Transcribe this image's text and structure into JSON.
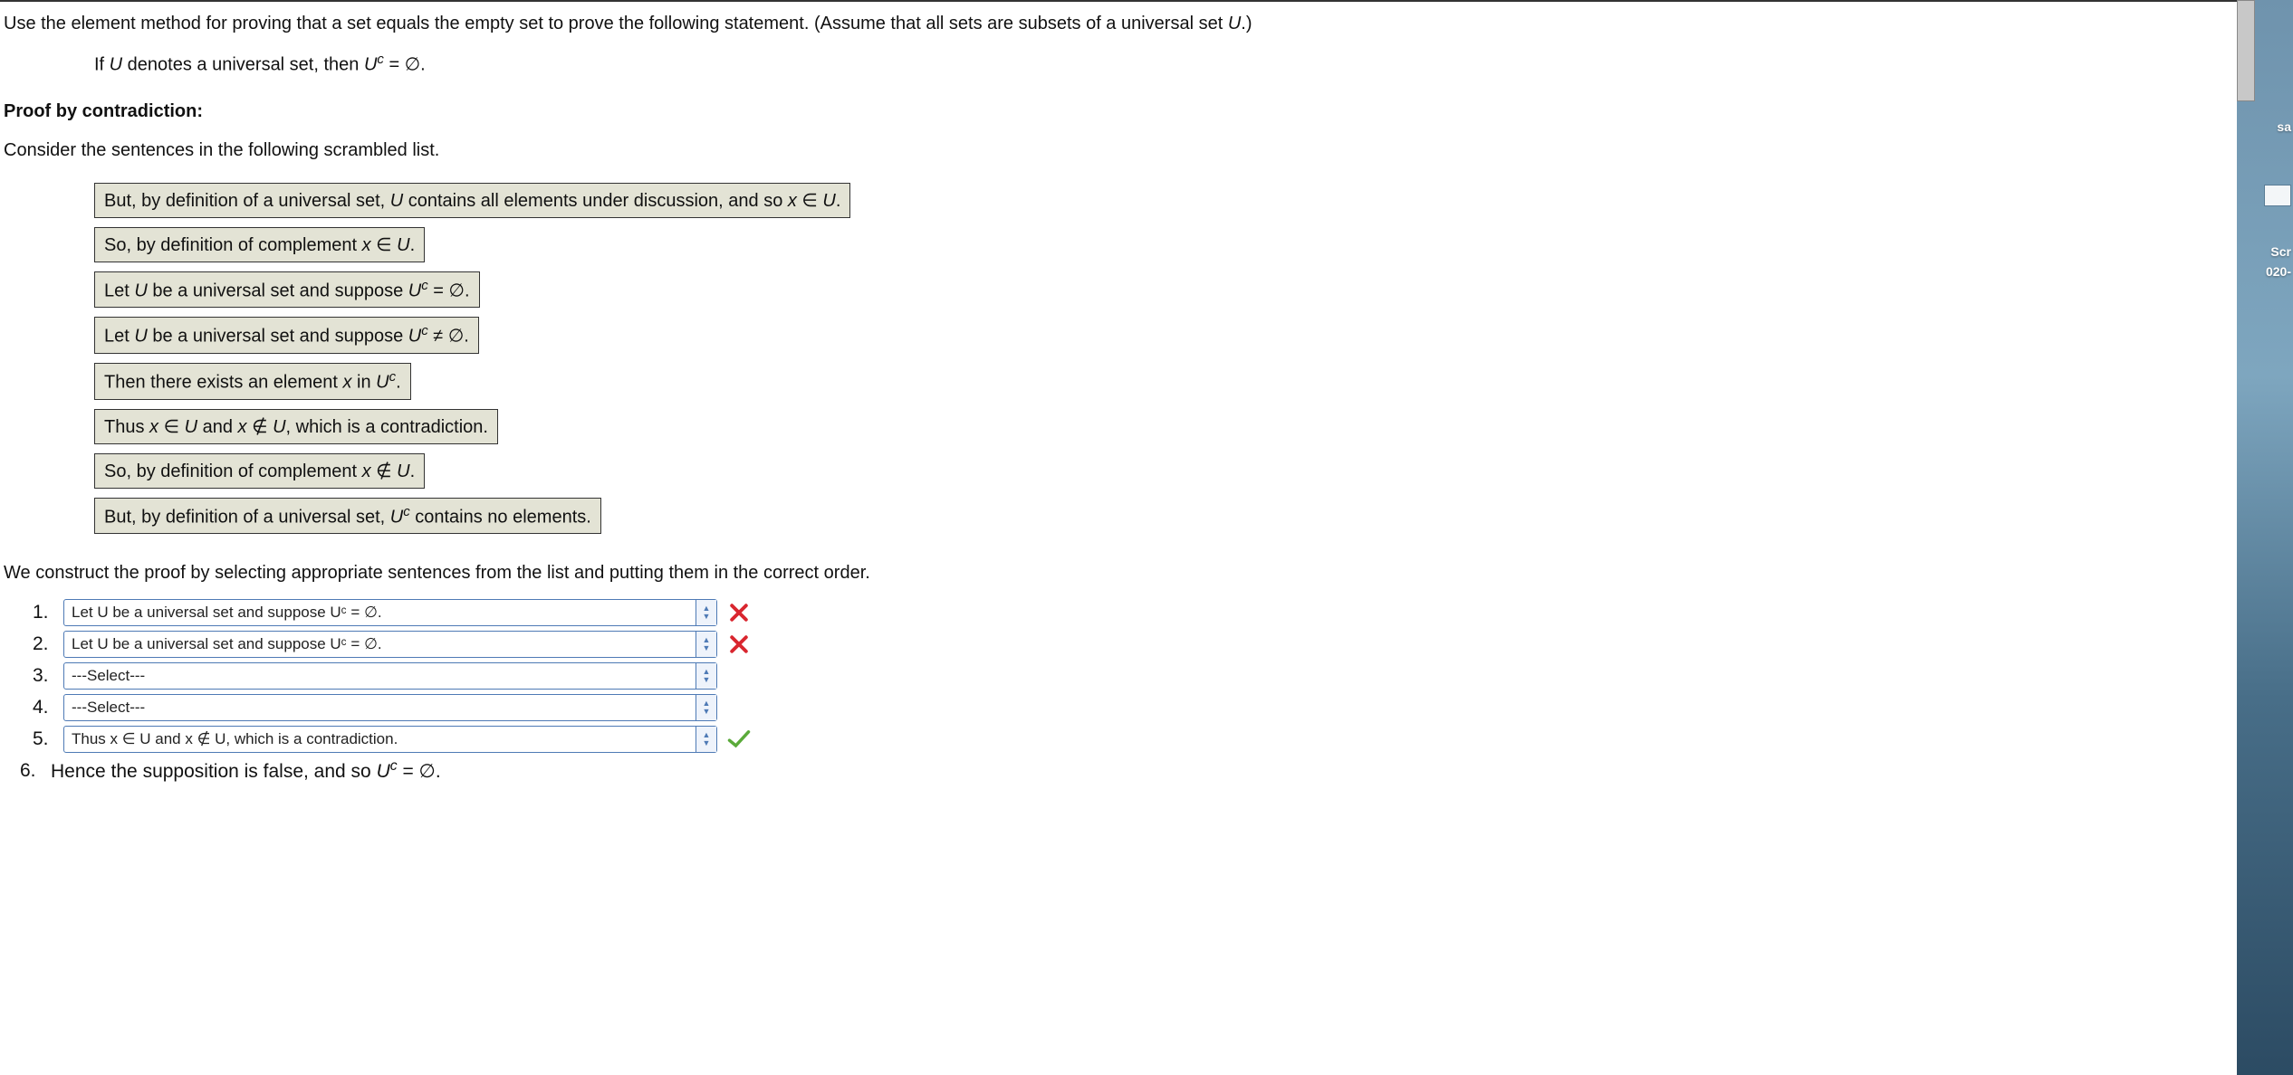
{
  "prompt": {
    "intro": "Use the element method for proving that a set equals the empty set to prove the following statement. (Assume that all sets are subsets of a universal set ",
    "intro_u": "U",
    "intro_end": ".)",
    "claim_pre": "If ",
    "claim_u": "U",
    "claim_mid": " denotes a universal set, then ",
    "claim_uc": "U",
    "claim_sup": "c",
    "claim_eq": " = ∅."
  },
  "headings": {
    "proof_by_contradiction": "Proof by contradiction:",
    "consider": "Consider the sentences in the following scrambled list.",
    "construct": "We construct the proof by selecting appropriate sentences from the list and putting them in the correct order."
  },
  "scrambled": [
    {
      "html": "But, by definition of a universal set, <span class='i'>U</span> contains all elements under discussion, and so <span class='i'>x</span> ∈ <span class='i'>U</span>."
    },
    {
      "html": "So, by definition of complement <span class='i'>x</span> ∈ <span class='i'>U</span>."
    },
    {
      "html": "Let <span class='i'>U</span> be a universal set and suppose <span class='i'>U</span><sup>c</sup> = ∅."
    },
    {
      "html": "Let <span class='i'>U</span> be a universal set and suppose <span class='i'>U</span><sup>c</sup> ≠ ∅."
    },
    {
      "html": "Then there exists an element <span class='i'>x</span> in <span class='i'>U</span><sup>c</sup>."
    },
    {
      "html": "Thus <span class='i'>x</span> ∈ <span class='i'>U</span> and <span class='i'>x</span> ∉ <span class='i'>U</span>, which is a contradiction."
    },
    {
      "html": "So, by definition of complement <span class='i'>x</span> ∉ <span class='i'>U</span>."
    },
    {
      "html": "But, by definition of a universal set, <span class='i'>U</span><sup>c</sup> contains no elements."
    }
  ],
  "ordered": [
    {
      "n": "1.",
      "value": "Let U be a universal set and suppose Uᶜ = ∅.",
      "mark": "wrong"
    },
    {
      "n": "2.",
      "value": "Let U be a universal set and suppose Uᶜ = ∅.",
      "mark": "wrong"
    },
    {
      "n": "3.",
      "value": "---Select---",
      "mark": "none"
    },
    {
      "n": "4.",
      "value": "---Select---",
      "mark": "none"
    },
    {
      "n": "5.",
      "value": "Thus x ∈ U and x ∉ U, which is a contradiction.",
      "mark": "correct"
    }
  ],
  "final": {
    "n": "6.",
    "text_pre": "Hence the supposition is false, and so ",
    "uc_u": "U",
    "uc_sup": "c",
    "text_post": " = ∅."
  },
  "sidebar": {
    "sa": "sa",
    "sc": "Scr",
    "yr": "020-"
  }
}
